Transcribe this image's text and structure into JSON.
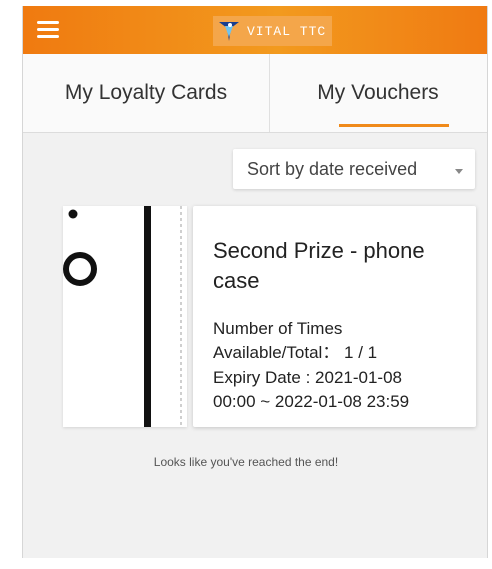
{
  "header": {
    "brand": "VITAL TTC",
    "menu_icon": "hamburger-menu-icon",
    "logo_icon": "vital-ttc-logo-icon",
    "colors": {
      "bar": "#f29a1e",
      "accent": "#f08a1a"
    }
  },
  "tabs": [
    {
      "label": "My Loyalty Cards",
      "active": false
    },
    {
      "label": "My Vouchers",
      "active": true
    }
  ],
  "sort": {
    "selected": "Sort by date received",
    "caret_icon": "caret-down-icon"
  },
  "vouchers": [
    {
      "title": "Second Prize - phone case",
      "times_label": "Number of Times",
      "avail_label": "Available/Total： 1 / 1",
      "expiry_label": "Expiry Date : 2021-01-08",
      "expiry_range": "00:00 ~ 2022-01-08 23:59"
    }
  ],
  "footer": {
    "end_message": "Looks like you've reached the end!"
  }
}
